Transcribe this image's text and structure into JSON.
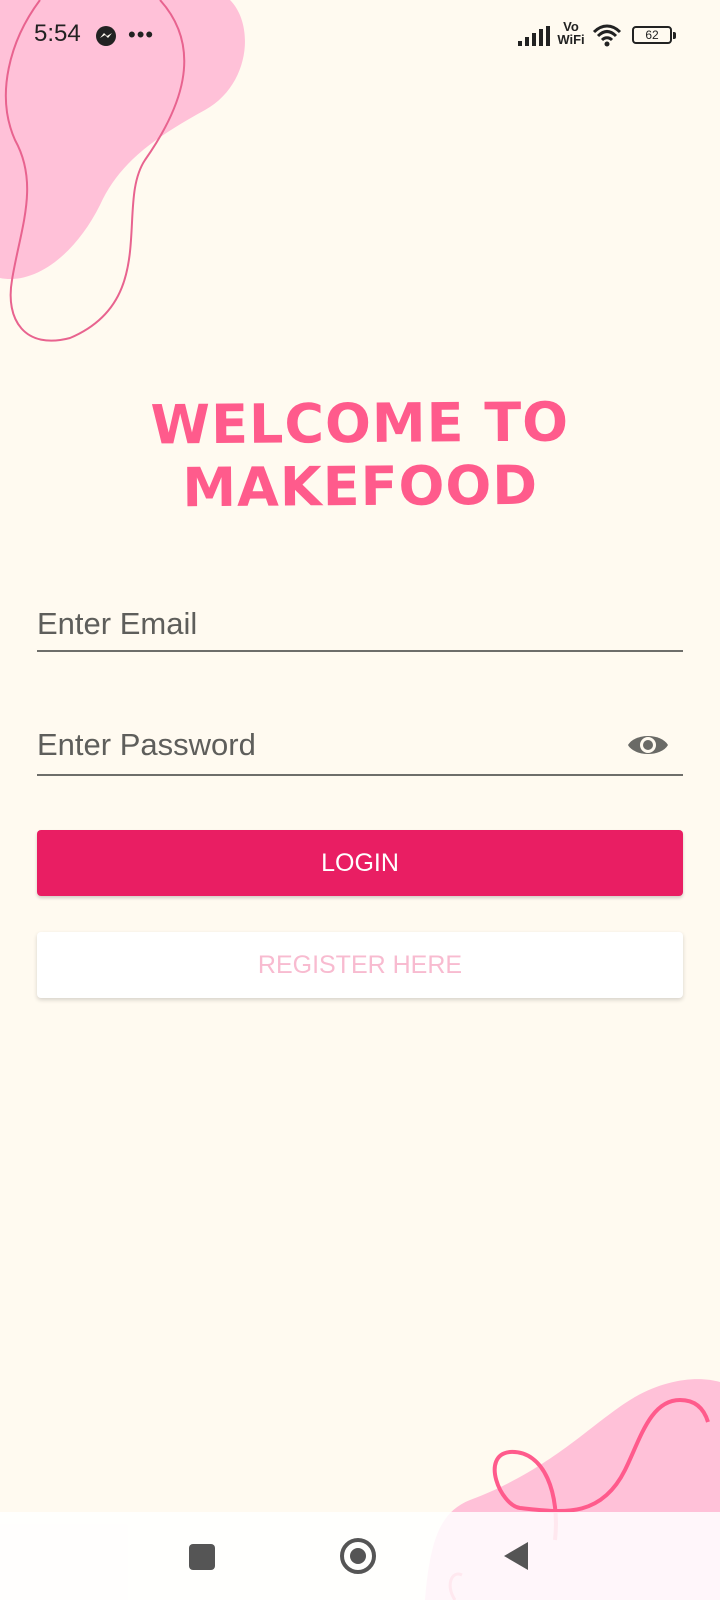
{
  "status_bar": {
    "time": "5:54",
    "vowifi_top": "Vo",
    "vowifi_bottom": "WiFi",
    "battery_level": "62",
    "icons": [
      "messenger-icon",
      "more-dots-icon",
      "signal-icon",
      "wifi-icon",
      "battery-icon"
    ]
  },
  "title": "WELCOME TO MAKEFOOD",
  "form": {
    "email_placeholder": "Enter Email",
    "email_value": "",
    "password_placeholder": "Enter Password",
    "password_value": "",
    "password_toggle_icon": "eye-icon"
  },
  "buttons": {
    "login": "LOGIN",
    "register": "REGISTER HERE"
  },
  "nav": {
    "icons": [
      "recent-apps-square-icon",
      "home-circle-icon",
      "back-triangle-icon"
    ]
  },
  "colors": {
    "background": "#fffaf0",
    "blob_pink": "#ffc1d8",
    "accent_pink": "#ff5b8c",
    "login_button": "#e91e63",
    "register_text": "#f8bbd0"
  }
}
